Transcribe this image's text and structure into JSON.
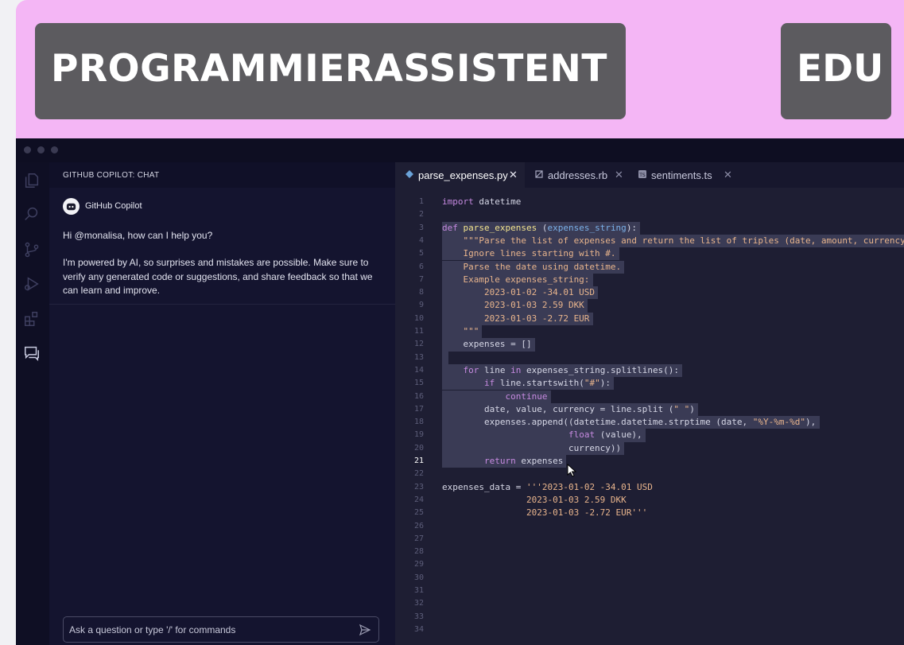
{
  "banner": {
    "title": "PROGRAMMIERASSISTENT",
    "badge": "EDU"
  },
  "activity_bar": {
    "icons": [
      "files-icon",
      "search-icon",
      "source-control-icon",
      "run-debug-icon",
      "extensions-icon",
      "chat-icon"
    ]
  },
  "chat": {
    "header": "GITHUB COPILOT: CHAT",
    "author": "GitHub Copilot",
    "greeting": "Hi @monalisa, how can I help you?",
    "disclaimer": "I'm powered by AI, so surprises and mistakes are possible. Make sure to verify any generated code or suggestions, and share feedback so that we can learn and improve.",
    "input_placeholder": "Ask a question or type '/' for commands"
  },
  "editor": {
    "tabs": [
      {
        "label": "parse_expenses.py",
        "active": true
      },
      {
        "label": "addresses.rb",
        "active": false
      },
      {
        "label": "sentiments.ts",
        "active": false
      }
    ],
    "current_line": 21,
    "lines": [
      {
        "n": "1",
        "code": "import datetime"
      },
      {
        "n": "2",
        "code": ""
      },
      {
        "n": "3",
        "code": "def parse_expenses (expenses_string):"
      },
      {
        "n": "4",
        "code": "    \"\"\"Parse the list of expenses and return the list of triples (date, amount, currency"
      },
      {
        "n": "5",
        "code": "    Ignore lines starting with #."
      },
      {
        "n": "6",
        "code": "    Parse the date using datetime."
      },
      {
        "n": "7",
        "code": "    Example expenses_string:"
      },
      {
        "n": "8",
        "code": "        2023-01-02 -34.01 USD"
      },
      {
        "n": "9",
        "code": "        2023-01-03 2.59 DKK"
      },
      {
        "n": "10",
        "code": "        2023-01-03 -2.72 EUR"
      },
      {
        "n": "11",
        "code": "    \"\"\""
      },
      {
        "n": "12",
        "code": "    expenses = []"
      },
      {
        "n": "13",
        "code": ""
      },
      {
        "n": "14",
        "code": "    for line in expenses_string.splitlines():"
      },
      {
        "n": "15",
        "code": "        if line.startswith(\"#\"):"
      },
      {
        "n": "16",
        "code": "            continue"
      },
      {
        "n": "17",
        "code": "        date, value, currency = line.split (\" \")"
      },
      {
        "n": "18",
        "code": "        expenses.append((datetime.datetime.strptime (date, \"%Y-%m-%d\"),"
      },
      {
        "n": "19",
        "code": "                        float (value),"
      },
      {
        "n": "20",
        "code": "                        currency))"
      },
      {
        "n": "21",
        "code": "        return expenses"
      },
      {
        "n": "22",
        "code": ""
      },
      {
        "n": "23",
        "code": "expenses_data = '''2023-01-02 -34.01 USD"
      },
      {
        "n": "24",
        "code": "                2023-01-03 2.59 DKK"
      },
      {
        "n": "25",
        "code": "                2023-01-03 -2.72 EUR'''"
      },
      {
        "n": "26",
        "code": ""
      },
      {
        "n": "27",
        "code": ""
      },
      {
        "n": "28",
        "code": ""
      },
      {
        "n": "29",
        "code": ""
      },
      {
        "n": "30",
        "code": ""
      },
      {
        "n": "31",
        "code": ""
      },
      {
        "n": "32",
        "code": ""
      },
      {
        "n": "33",
        "code": ""
      },
      {
        "n": "34",
        "code": ""
      }
    ]
  },
  "colors": {
    "banner_bg": "#f4b6f5",
    "banner_box": "#5c5b5f",
    "ide_bg": "#13132b",
    "editor_bg": "#1e1e33",
    "selection": "#3a3b55",
    "keyword": "#c68ae0",
    "function": "#f2e38e",
    "string": "#e8b48c",
    "param": "#7ab0e8"
  }
}
